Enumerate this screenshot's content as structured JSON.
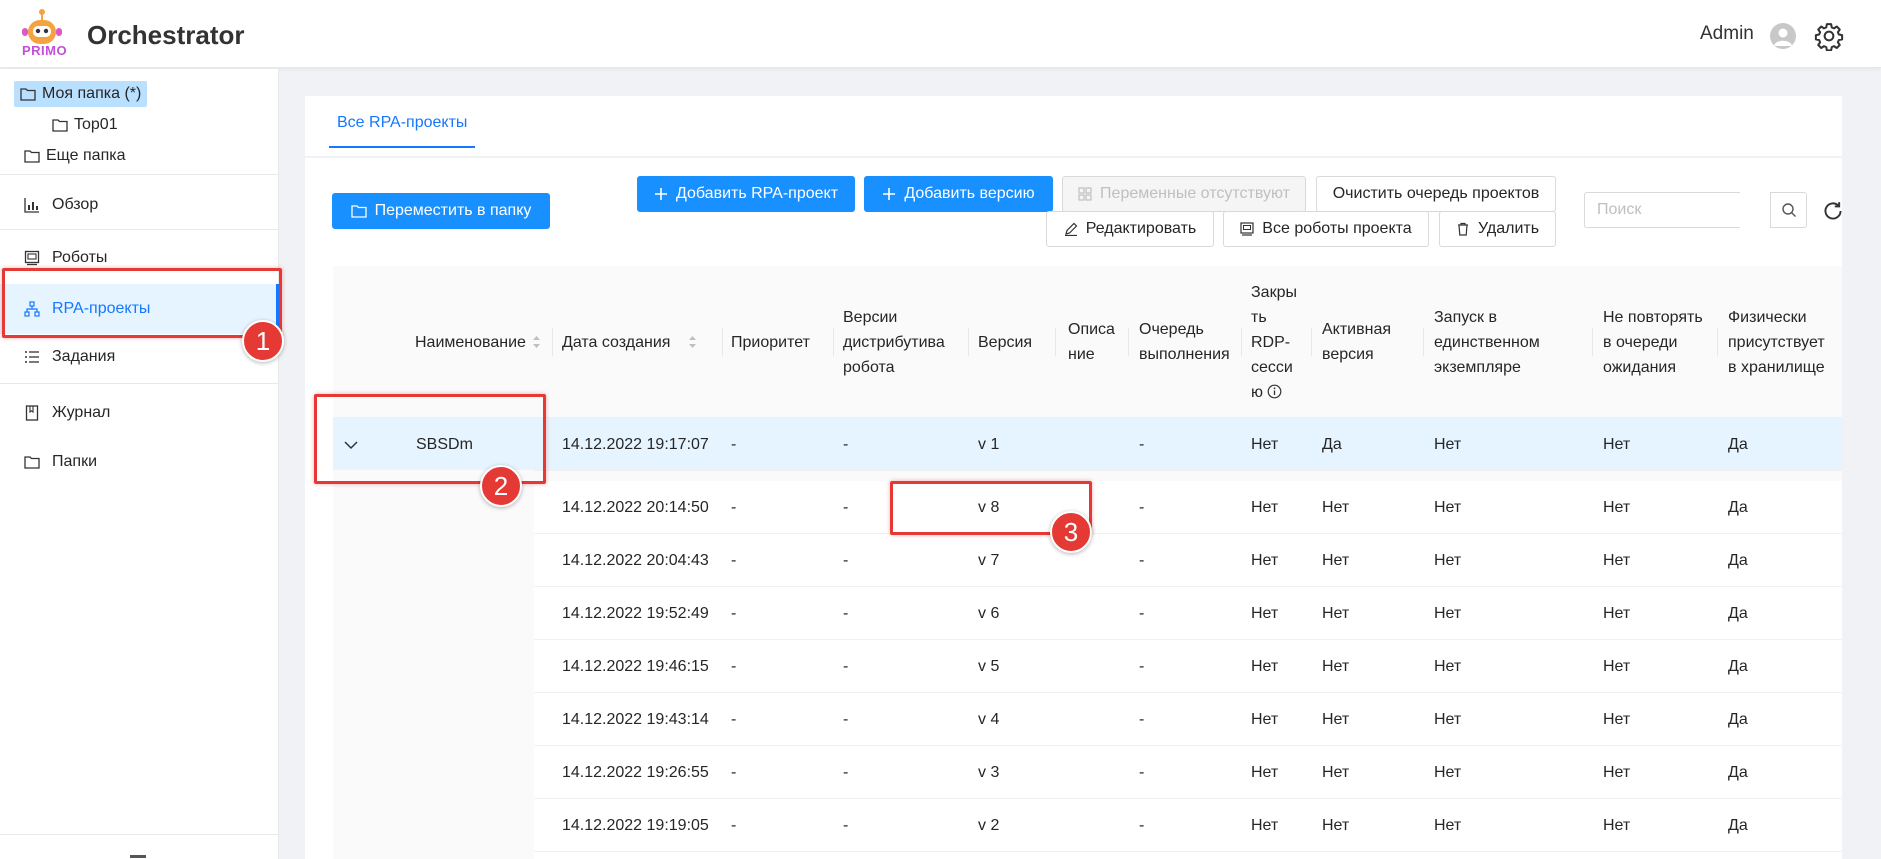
{
  "header": {
    "logo_text": "PRIMO",
    "app_title": "Orchestrator",
    "user_name": "Admin"
  },
  "sidebar": {
    "tree": [
      {
        "label": "Моя папка (*)",
        "selected": true
      },
      {
        "label": "Top01",
        "selected": false
      },
      {
        "label": "Еще папка",
        "selected": false
      }
    ],
    "nav": [
      {
        "label": "Обзор",
        "icon": "bar-chart-icon",
        "active": false
      },
      {
        "label": "Роботы",
        "icon": "robot-icon",
        "active": false
      },
      {
        "label": "RPA-проекты",
        "icon": "hierarchy-icon",
        "active": true
      },
      {
        "label": "Задания",
        "icon": "list-icon",
        "active": false
      },
      {
        "label": "Журнал",
        "icon": "book-icon",
        "active": false
      },
      {
        "label": "Папки",
        "icon": "folder-icon",
        "active": false
      }
    ]
  },
  "tabs": [
    {
      "label": "Все RPA-проекты",
      "active": true
    }
  ],
  "toolbar": {
    "move_to_folder": "Переместить в папку",
    "add_project": "Добавить RPA-проект",
    "add_version": "Добавить версию",
    "no_variables": "Переменные отсутствуют",
    "clear_queue": "Очистить очередь проектов",
    "edit": "Редактировать",
    "all_robots": "Все роботы проекта",
    "delete": "Удалить",
    "search_placeholder": "Поиск"
  },
  "table": {
    "columns": [
      "Наименование",
      "Дата создания",
      "Приоритет",
      "Версии дистрибутива робота",
      "Версия",
      "Описание",
      "Очередь выполнения",
      "Закрыть RDP-сессию",
      "Активная версия",
      "Запуск в единственном экземпляре",
      "Не повторять в очереди ожидания",
      "Физически присутствует в хранилище"
    ],
    "column_lines": {
      "versions_dist": [
        "Версии",
        "дистрибутива",
        "робота"
      ],
      "description": [
        "Описа",
        "ние"
      ],
      "queue": [
        "Очередь",
        "выполнения"
      ],
      "rdp": [
        "Закры",
        "ть",
        "RDP-",
        "сесси",
        "ю"
      ],
      "active": [
        "Активная",
        "версия"
      ],
      "single": [
        "Запуск в",
        "единственном",
        "экземпляре"
      ],
      "norepeat": [
        "Не повторять",
        "в очереди",
        "ожидания"
      ],
      "physical": [
        "Физически",
        "присутствует",
        "в хранилище"
      ]
    },
    "parent_row": {
      "name": "SBSDm",
      "created": "14.12.2022 19:17:07",
      "priority": "-",
      "dist": "-",
      "version": "v 1",
      "description": "",
      "queue": "-",
      "rdp": "Нет",
      "active": "Да",
      "single": "Нет",
      "norepeat": "Нет",
      "physical": "Да"
    },
    "child_rows": [
      {
        "created": "14.12.2022 20:14:50",
        "priority": "-",
        "dist": "-",
        "version": "v 8",
        "queue": "-",
        "rdp": "Нет",
        "active": "Нет",
        "single": "Нет",
        "norepeat": "Нет",
        "physical": "Да"
      },
      {
        "created": "14.12.2022 20:04:43",
        "priority": "-",
        "dist": "-",
        "version": "v 7",
        "queue": "-",
        "rdp": "Нет",
        "active": "Нет",
        "single": "Нет",
        "norepeat": "Нет",
        "physical": "Да"
      },
      {
        "created": "14.12.2022 19:52:49",
        "priority": "-",
        "dist": "-",
        "version": "v 6",
        "queue": "-",
        "rdp": "Нет",
        "active": "Нет",
        "single": "Нет",
        "norepeat": "Нет",
        "physical": "Да"
      },
      {
        "created": "14.12.2022 19:46:15",
        "priority": "-",
        "dist": "-",
        "version": "v 5",
        "queue": "-",
        "rdp": "Нет",
        "active": "Нет",
        "single": "Нет",
        "norepeat": "Нет",
        "physical": "Да"
      },
      {
        "created": "14.12.2022 19:43:14",
        "priority": "-",
        "dist": "-",
        "version": "v 4",
        "queue": "-",
        "rdp": "Нет",
        "active": "Нет",
        "single": "Нет",
        "norepeat": "Нет",
        "physical": "Да"
      },
      {
        "created": "14.12.2022 19:26:55",
        "priority": "-",
        "dist": "-",
        "version": "v 3",
        "queue": "-",
        "rdp": "Нет",
        "active": "Нет",
        "single": "Нет",
        "norepeat": "Нет",
        "physical": "Да"
      },
      {
        "created": "14.12.2022 19:19:05",
        "priority": "-",
        "dist": "-",
        "version": "v 2",
        "queue": "-",
        "rdp": "Нет",
        "active": "Нет",
        "single": "Нет",
        "norepeat": "Нет",
        "physical": "Да"
      }
    ]
  },
  "annotations": [
    {
      "label": "1"
    },
    {
      "label": "2"
    },
    {
      "label": "3"
    }
  ],
  "colors": {
    "primary": "#1890ff",
    "annotation": "#e53935",
    "selected_folder": "#bae0ff",
    "active_nav": "#e6f4ff"
  }
}
